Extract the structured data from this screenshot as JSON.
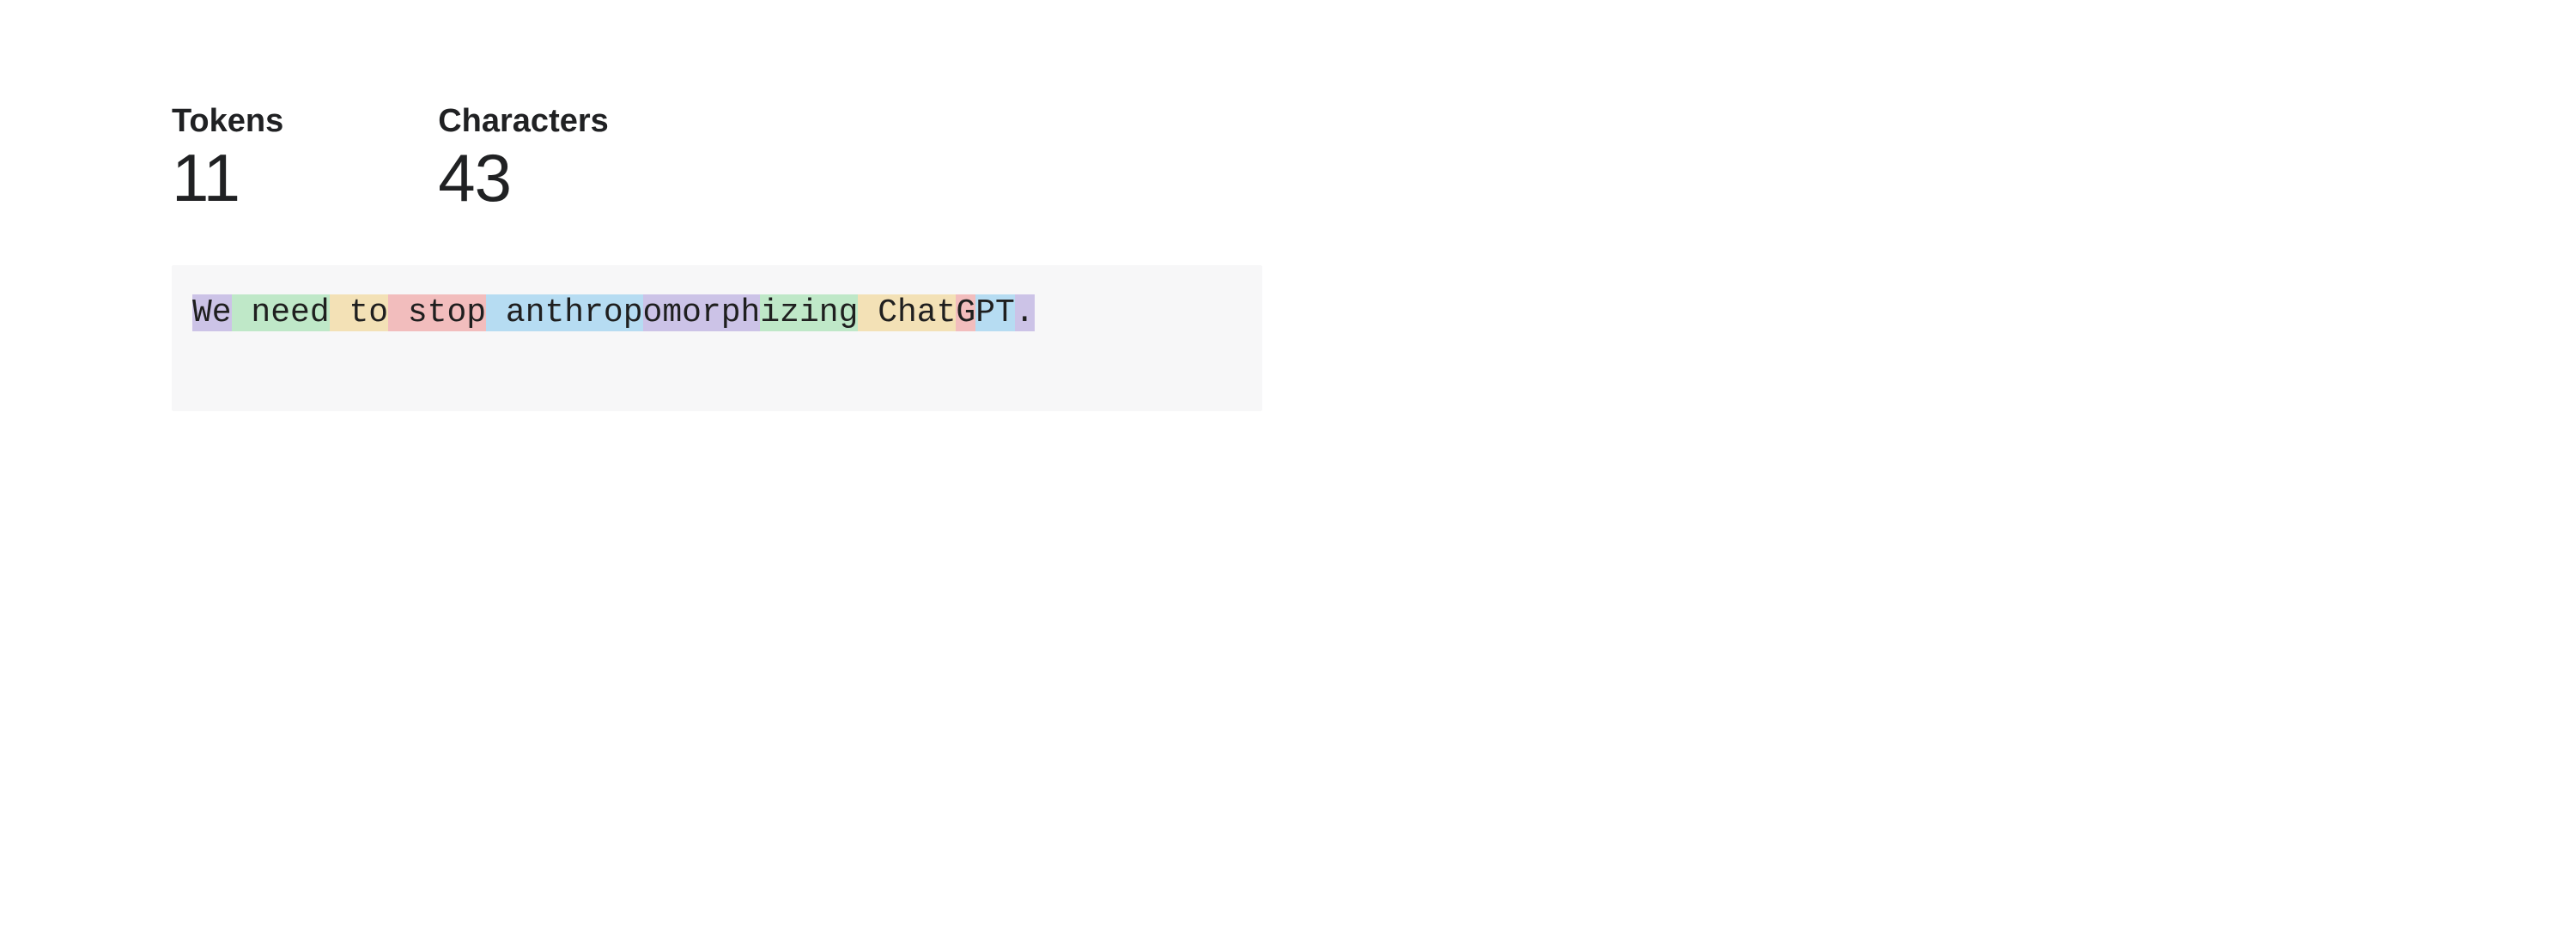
{
  "stats": {
    "tokens_label": "Tokens",
    "tokens_value": "11",
    "characters_label": "Characters",
    "characters_value": "43"
  },
  "token_colors": {
    "purple": "#ccc3e7",
    "green": "#bfe8c8",
    "yellow": "#f3e1b6",
    "red": "#f2bdbd",
    "blue": "#b6dcf2"
  },
  "tokens": [
    {
      "text": "We",
      "color": "purple"
    },
    {
      "text": " need",
      "color": "green"
    },
    {
      "text": " to",
      "color": "yellow"
    },
    {
      "text": " stop",
      "color": "red"
    },
    {
      "text": " anthrop",
      "color": "blue"
    },
    {
      "text": "omorph",
      "color": "purple"
    },
    {
      "text": "izing",
      "color": "green"
    },
    {
      "text": " Chat",
      "color": "yellow"
    },
    {
      "text": "G",
      "color": "red"
    },
    {
      "text": "PT",
      "color": "blue"
    },
    {
      "text": ".",
      "color": "purple"
    }
  ]
}
